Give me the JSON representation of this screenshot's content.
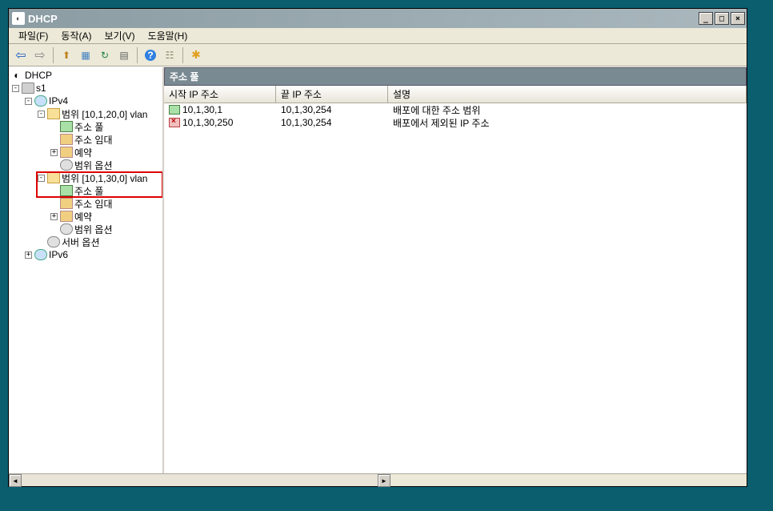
{
  "window": {
    "title": "DHCP"
  },
  "menu": {
    "file": "파일(F)",
    "action": "동작(A)",
    "view": "보기(V)",
    "help": "도움말(H)"
  },
  "toolbar_icons": {
    "back": "←",
    "forward": "→",
    "up": "↑",
    "props": "☰",
    "refresh": "↻",
    "export": "▤",
    "help": "?",
    "filter": "☷",
    "star": "✱"
  },
  "tree": {
    "root": "DHCP",
    "server": "s1",
    "ipv4": "IPv4",
    "scope1": "범위 [10,1,20,0] vlan",
    "scope2": "범위 [10,1,30,0] vlan",
    "address_pool": "주소 풀",
    "address_lease": "주소 임대",
    "reservation": "예약",
    "scope_options": "범위 옵션",
    "server_options": "서버 옵션",
    "ipv6": "IPv6"
  },
  "content": {
    "header": "주소 풀",
    "columns": {
      "start_ip": "시작 IP 주소",
      "end_ip": "끝 IP 주소",
      "description": "설명"
    },
    "rows": [
      {
        "icon": "range",
        "start": "10,1,30,1",
        "end": "10,1,30,254",
        "desc": "배포에 대한 주소 범위"
      },
      {
        "icon": "exclude",
        "start": "10,1,30,250",
        "end": "10,1,30,254",
        "desc": "배포에서 제외된 IP 주소"
      }
    ]
  }
}
